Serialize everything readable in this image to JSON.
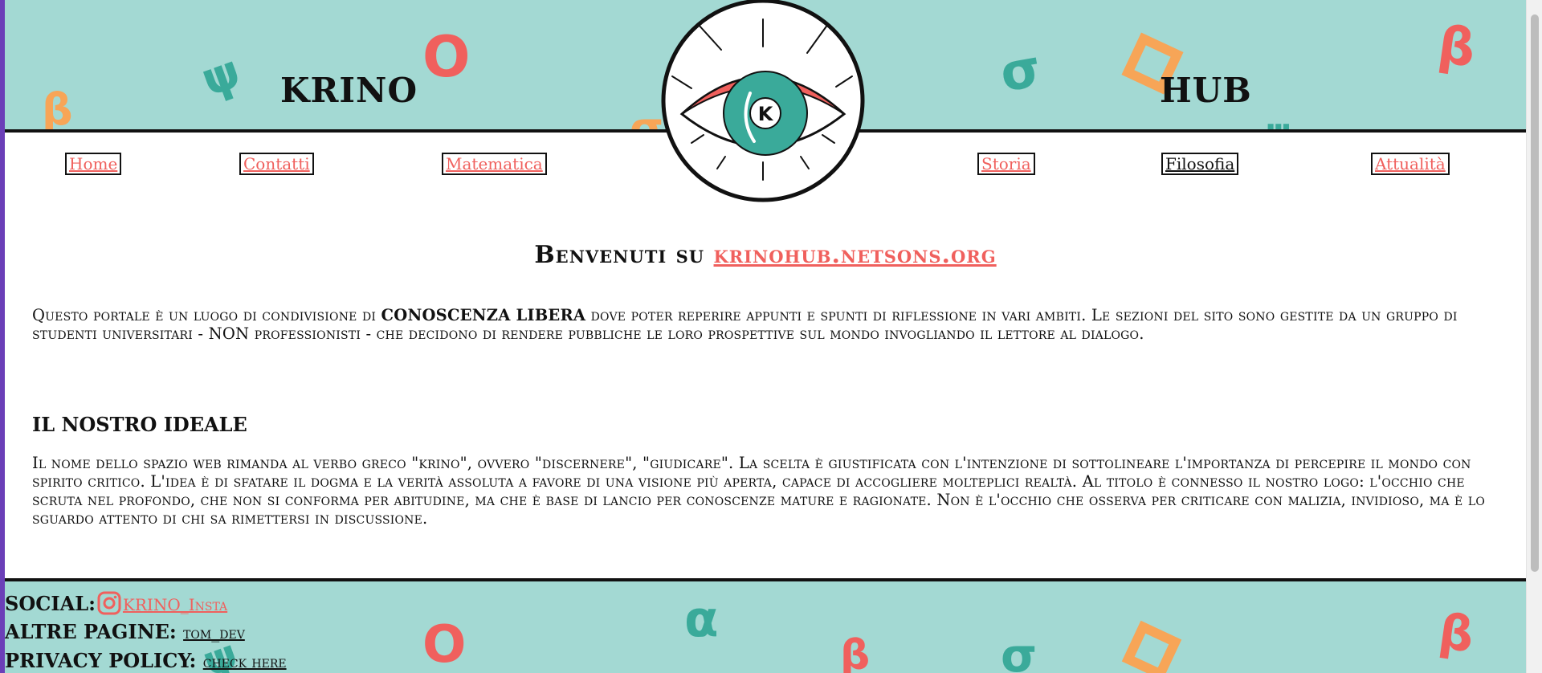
{
  "header": {
    "title_left": "KRINO",
    "title_right": "HUB",
    "logo_letter": "K"
  },
  "nav": {
    "items": [
      {
        "label": "Home"
      },
      {
        "label": "Contatti"
      },
      {
        "label": "Matematica"
      },
      {
        "label": "Storia"
      },
      {
        "label": "Filosofia"
      },
      {
        "label": "Attualità"
      }
    ]
  },
  "main": {
    "welcome_prefix": "Benvenuti su",
    "welcome_link": "krinohub.netsons.org",
    "intro_before": "Questo portale è un luogo di condivisione di ",
    "intro_bold": "CONOSCENZA LIBERA",
    "intro_after": " dove poter reperire appunti e spunti di riflessione in vari ambiti. Le sezioni del sito sono gestite da un gruppo di studenti universitari - NON professionisti - che decidono di rendere pubbliche le loro prospettive sul mondo invogliando il lettore al dialogo.",
    "ideal_heading": "IL NOSTRO IDEALE",
    "ideal_text": "Il nome dello spazio web rimanda al verbo greco \"krino\", ovvero \"discernere\", \"giudicare\". La scelta è giustificata con l'intenzione di sottolineare l'importanza di percepire il mondo con spirito critico. L'idea è di sfatare il dogma e la verità assoluta a favore di una visione più aperta, capace di accogliere molteplici realtà. Al titolo è connesso il nostro logo: l'occhio che scruta nel profondo, che non si conforma per abitudine, ma che è base di lancio per conoscenze mature e ragionate. Non è l'occhio che osserva per criticare con malizia, invidioso, ma è lo sguardo attento di chi sa rimettersi in discussione."
  },
  "footer": {
    "social_label": "SOCIAL:",
    "social_link": "KRINO_Insta",
    "other_label": "ALTRE PAGINE:",
    "other_link": "tom_dev",
    "privacy_label": "PRIVACY POLICY:",
    "privacy_link": "check here"
  },
  "colors": {
    "teal_bg": "#a3d9d3",
    "accent_red": "#f0605d",
    "deco_orange": "#f7a557",
    "deco_teal": "#3aaa9a"
  }
}
